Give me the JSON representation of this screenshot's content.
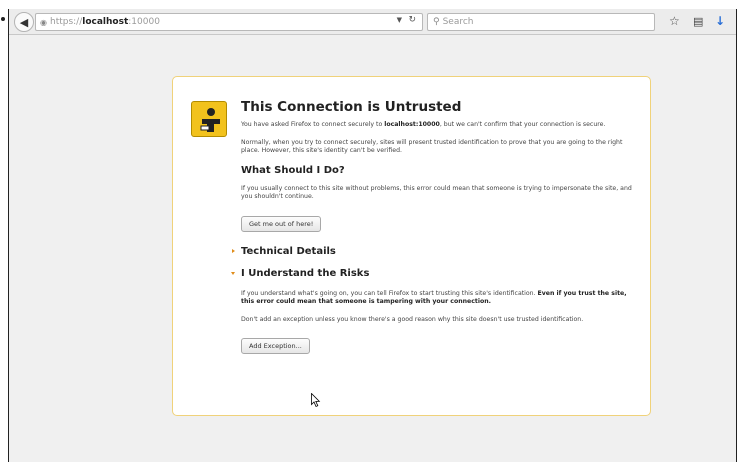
{
  "toolbar": {
    "back_icon": "back-arrow-icon",
    "url": {
      "scheme": "https://",
      "host": "localhost",
      "port": ":10000"
    },
    "search_placeholder": "Search",
    "icons": [
      "globe-icon",
      "dropdown-icon",
      "reload-icon",
      "search-icon",
      "star-icon",
      "library-icon",
      "download-icon"
    ]
  },
  "error": {
    "title": "This Connection is Untrusted",
    "intro_prefix": "You have asked Firefox to connect securely to ",
    "intro_host": "localhost:10000",
    "intro_suffix": ", but we can't confirm that your connection is secure.",
    "normally": "Normally, when you try to connect securely, sites will present trusted identification to prove that you are going to the right place. However, this site's identity can't be verified.",
    "what_heading": "What Should I Do?",
    "what_text": "If you usually connect to this site without problems, this error could mean that someone is trying to impersonate the site, and you shouldn't continue.",
    "get_out_label": "Get me out of here!",
    "technical_label": "Technical Details",
    "risks_label": "I Understand the Risks",
    "risks_text_prefix": "If you understand what's going on, you can tell Firefox to start trusting this site's identification. ",
    "risks_text_bold": "Even if you trust the site, this error could mean that someone is tampering with your connection.",
    "exception_note": "Don't add an exception unless you know there's a good reason why this site doesn't use trusted identification.",
    "add_exception_label": "Add Exception..."
  },
  "colors": {
    "warning_icon": "#f2c21d",
    "box_border": "#f0d27a",
    "expander": "#e08c1a",
    "download_icon": "#2a6fd6"
  }
}
